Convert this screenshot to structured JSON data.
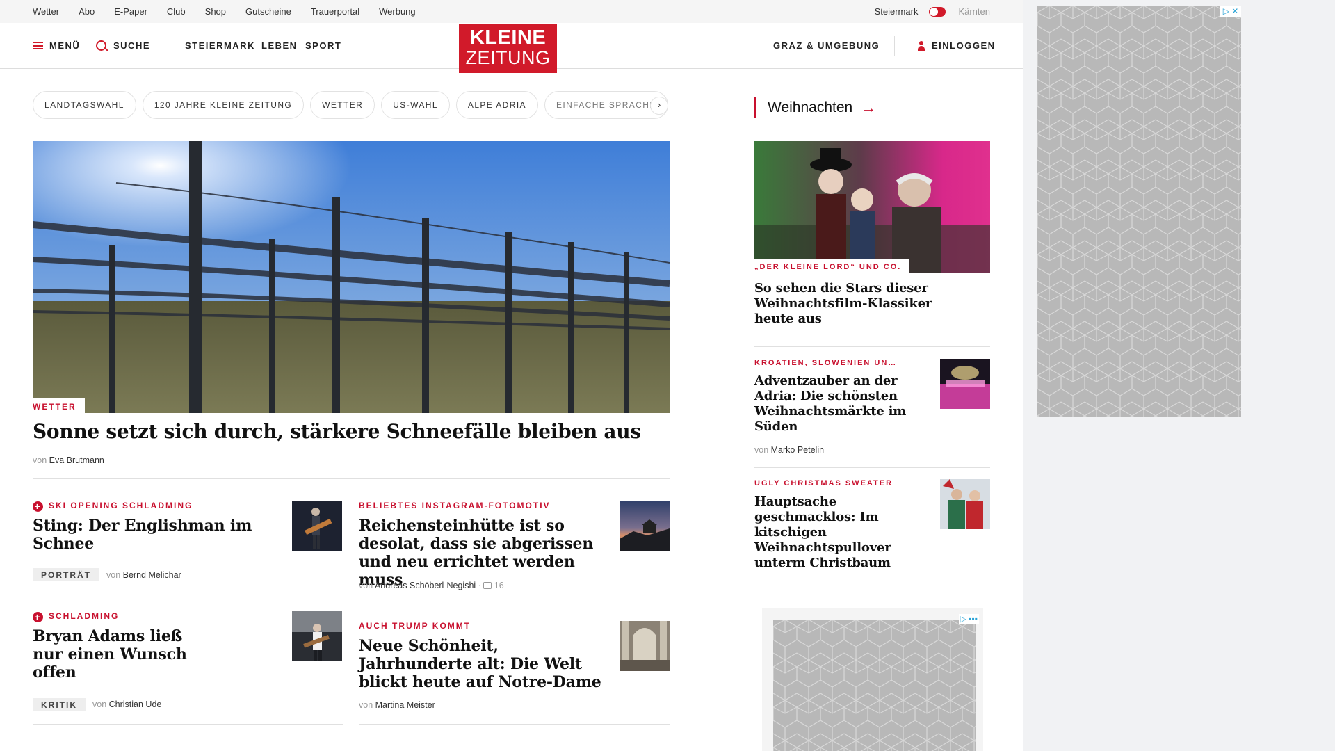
{
  "utility_bar": {
    "links": [
      "Wetter",
      "Abo",
      "E-Paper",
      "Club",
      "Shop",
      "Gutscheine",
      "Trauerportal",
      "Werbung"
    ],
    "region_active": "Steiermark",
    "region_inactive": "Kärnten"
  },
  "header": {
    "menu_label": "MENÜ",
    "search_label": "SUCHE",
    "nav": [
      "STEIERMARK",
      "LEBEN",
      "SPORT"
    ],
    "logo_line1": "KLEINE",
    "logo_line2": "ZEITUNG",
    "local_label": "GRAZ & UMGEBUNG",
    "login_label": "EINLOGGEN"
  },
  "topic_chips": [
    "LANDTAGSWAHL",
    "120 JAHRE KLEINE ZEITUNG",
    "WETTER",
    "US-WAHL",
    "ALPE ADRIA",
    "EINFACHE SPRACHE"
  ],
  "hero": {
    "kicker": "WETTER",
    "title": "Sonne setzt sich durch, stärkere Schneefälle bleiben aus",
    "byline_prefix": "von",
    "author": "Eva Brutmann"
  },
  "articles": [
    {
      "kicker": "SKI OPENING SCHLADMING",
      "title": "Sting: Der Englishman im Schnee",
      "tag": "PORTRÄT",
      "byline_prefix": "von",
      "author": "Bernd Melichar"
    },
    {
      "kicker": "BELIEBTES INSTAGRAM-FOTOMOTIV",
      "title": "Reichensteinhütte ist so desolat, dass sie abgerissen und neu errichtet werden muss",
      "byline_prefix": "von",
      "author": "Andreas Schöberl-Negishi",
      "comments": "16"
    },
    {
      "kicker": "SCHLADMING",
      "title": "Bryan Adams ließ nur einen Wunsch offen",
      "tag": "KRITIK",
      "byline_prefix": "von",
      "author": "Christian Ude"
    },
    {
      "kicker": "AUCH TRUMP KOMMT",
      "title": "Neue Schönheit, Jahrhunderte alt: Die Welt blickt heute auf Notre-Dame",
      "byline_prefix": "von",
      "author": "Martina Meister"
    }
  ],
  "sidebar": {
    "section_title": "Weihnachten",
    "featured": {
      "kicker": "„DER KLEINE LORD“ UND CO.",
      "title": "So sehen die Stars dieser Weihnachtsfilm-Klassiker heute aus"
    },
    "items": [
      {
        "kicker": "KROATIEN, SLOWENIEN UN…",
        "title": "Adventzauber an der Adria: Die schönsten Weihnachtsmärkte im Süden",
        "byline_prefix": "von",
        "author": "Marko Petelin"
      },
      {
        "kicker": "UGLY CHRISTMAS SWEATER",
        "title": "Hauptsache geschmacklos: Im kitschigen Weihnachtspullover unterm Christbaum"
      }
    ]
  },
  "colors": {
    "brand_red": "#d11a2a",
    "kicker_red": "#c8102e"
  }
}
